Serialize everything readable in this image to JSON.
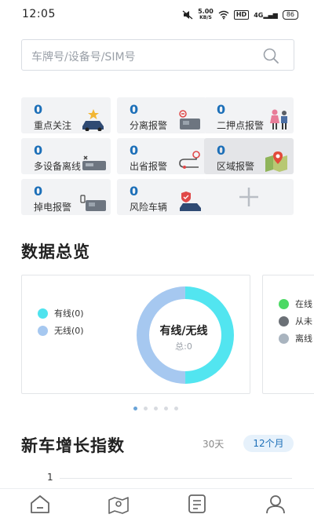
{
  "status_bar": {
    "time": "12:05",
    "speed_value": "5.00",
    "speed_unit": "KB/S",
    "hd_badge": "HD",
    "network": "4G",
    "battery": "86"
  },
  "search": {
    "placeholder": "车牌号/设备号/SIM号",
    "icon": "search-icon"
  },
  "quick_tiles": [
    {
      "count": "0",
      "label": "重点关注",
      "icon": "car-star-icon"
    },
    {
      "count": "0",
      "label": "分离报警",
      "icon": "device-split-icon"
    },
    {
      "count": "0",
      "label": "二押点报警",
      "icon": "people-alert-icon"
    },
    {
      "count": "0",
      "label": "多设备离线",
      "icon": "car-offline-icon"
    },
    {
      "count": "0",
      "label": "出省报警",
      "icon": "route-icon"
    },
    {
      "count": "0",
      "label": "区域报警",
      "icon": "map-pin-icon"
    },
    {
      "count": "0",
      "label": "掉电报警",
      "icon": "battery-car-icon"
    },
    {
      "count": "0",
      "label": "风险车辆",
      "icon": "car-shield-icon"
    },
    {
      "icon": "plus-icon"
    }
  ],
  "overview": {
    "title": "数据总览",
    "card1": {
      "legend": [
        {
          "label": "有线(0)",
          "color": "#4fe3ee"
        },
        {
          "label": "无线(0)",
          "color": "#a6c8f0"
        }
      ],
      "donut_title": "有线/无线",
      "donut_sub": "总:0",
      "colors": {
        "wired": "#52e5f0",
        "wireless": "#a6c8f0"
      },
      "share": {
        "wired": 0.5,
        "wireless": 0.5
      }
    },
    "card2": {
      "legend": [
        {
          "label": "在线",
          "color": "#4cd964"
        },
        {
          "label": "从未",
          "color": "#6b7076"
        },
        {
          "label": "离线",
          "color": "#a9b4bf"
        }
      ]
    },
    "pager": {
      "count": 5,
      "active": 0
    }
  },
  "growth": {
    "title": "新车增长指数",
    "range_30": "30天",
    "range_12": "12个月",
    "y_top": "1"
  },
  "tabbar": [
    {
      "icon": "home-icon"
    },
    {
      "icon": "map-icon"
    },
    {
      "icon": "list-icon"
    },
    {
      "icon": "profile-icon"
    }
  ]
}
